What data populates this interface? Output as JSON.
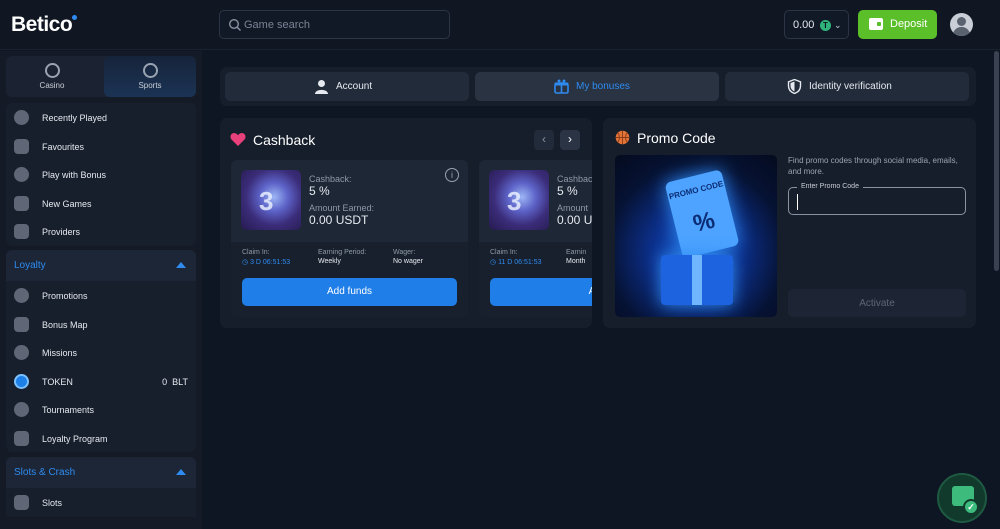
{
  "header": {
    "logo": "Betico",
    "search_placeholder": "Game search",
    "balance": "0.00",
    "coin_symbol": "T",
    "deposit_label": "Deposit"
  },
  "sidebar": {
    "modes": [
      {
        "label": "Casino",
        "icon": "casino-chip-icon"
      },
      {
        "label": "Sports",
        "icon": "soccer-ball-icon",
        "active": true
      }
    ],
    "main_items": [
      {
        "label": "Recently Played",
        "icon": "clock-icon"
      },
      {
        "label": "Favourites",
        "icon": "heart-icon"
      },
      {
        "label": "Play with Bonus",
        "icon": "bonus-coins-icon"
      },
      {
        "label": "New Games",
        "icon": "new-games-icon"
      },
      {
        "label": "Providers",
        "icon": "providers-icon"
      }
    ],
    "loyalty": {
      "label": "Loyalty",
      "items": [
        {
          "label": "Promotions",
          "icon": "percent-icon"
        },
        {
          "label": "Bonus Map",
          "icon": "map-icon"
        },
        {
          "label": "Missions",
          "icon": "spaceship-icon"
        },
        {
          "label": "TOKEN",
          "icon": "token-icon",
          "value": "0",
          "unit": "BLT"
        },
        {
          "label": "Tournaments",
          "icon": "trophy-icon"
        },
        {
          "label": "Loyalty Program",
          "icon": "loyalty-icon"
        }
      ]
    },
    "slots_crash": {
      "label": "Slots & Crash",
      "items": [
        {
          "label": "Slots",
          "icon": "slots-icon"
        }
      ]
    }
  },
  "tabs": [
    {
      "label": "Account",
      "icon": "user-icon"
    },
    {
      "label": "My bonuses",
      "icon": "gift-icon",
      "active": true
    },
    {
      "label": "Identity verification",
      "icon": "shield-icon"
    }
  ],
  "cashback": {
    "title": "Cashback",
    "cards": [
      {
        "cashback_label": "Cashback:",
        "cashback_value": "5 %",
        "earned_label": "Amount Earned:",
        "earned_value": "0.00 USDT",
        "claim_label": "Claim In:",
        "claim_value": "3 D 06:51:53",
        "period_label": "Earning Period:",
        "period_value": "Weekly",
        "wager_label": "Wager:",
        "wager_value": "No wager",
        "button": "Add funds"
      },
      {
        "cashback_label": "Cashbac",
        "cashback_value": "5 %",
        "earned_label": "Amount",
        "earned_value": "0.00 U",
        "claim_label": "Claim In:",
        "claim_value": "11 D 06:51:53",
        "period_label": "Earnin",
        "period_value": "Month",
        "button": "Add"
      }
    ]
  },
  "promo": {
    "title": "Promo Code",
    "description": "Find promo codes through social media, emails, and more.",
    "field_label": "Enter Promo Code",
    "field_value": "",
    "ticket_text": "PROMO CODE",
    "ticket_symbol": "%",
    "button": "Activate"
  },
  "colors": {
    "accent": "#2e8bf0",
    "deposit": "#5bbf2a",
    "background": "#0f1623"
  }
}
